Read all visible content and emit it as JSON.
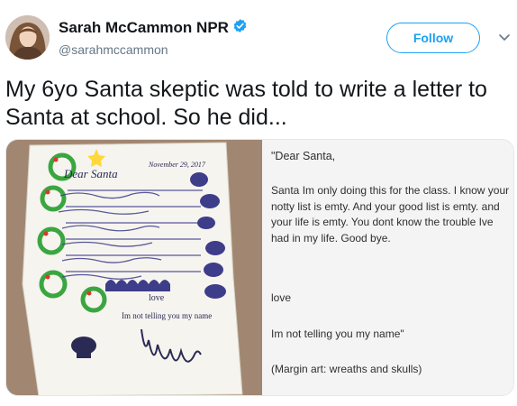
{
  "author": {
    "name": "Sarah McCammon NPR",
    "handle": "@sarahmccammon",
    "verified": true
  },
  "follow_button": {
    "label": "Follow"
  },
  "tweet": {
    "text": "My 6yo Santa skeptic was told to write a letter to Santa at school. So he did..."
  },
  "transcript": {
    "greeting": "\"Dear Santa,",
    "body": "Santa Im only doing this for the class. I know your notty list is emty. And your good list is emty. and your life is emty. You dont know the trouble Ive had in my life. Good bye.",
    "closing": "love",
    "signoff": "Im not telling you my name\"",
    "note": "(Margin art: wreaths and skulls)"
  },
  "letter_image": {
    "greeting": "Dear Santa",
    "date": "November 29, 2017",
    "closing": "love",
    "signoff": "Im not telling you my name"
  },
  "colors": {
    "accent": "#1da1f2",
    "text": "#14171a",
    "secondary_text": "#657786",
    "wreath_green": "#3aa640",
    "skull_ink": "#2a2a55"
  },
  "icons": {
    "verified": "verified-badge-icon",
    "chevron": "chevron-down-icon"
  }
}
